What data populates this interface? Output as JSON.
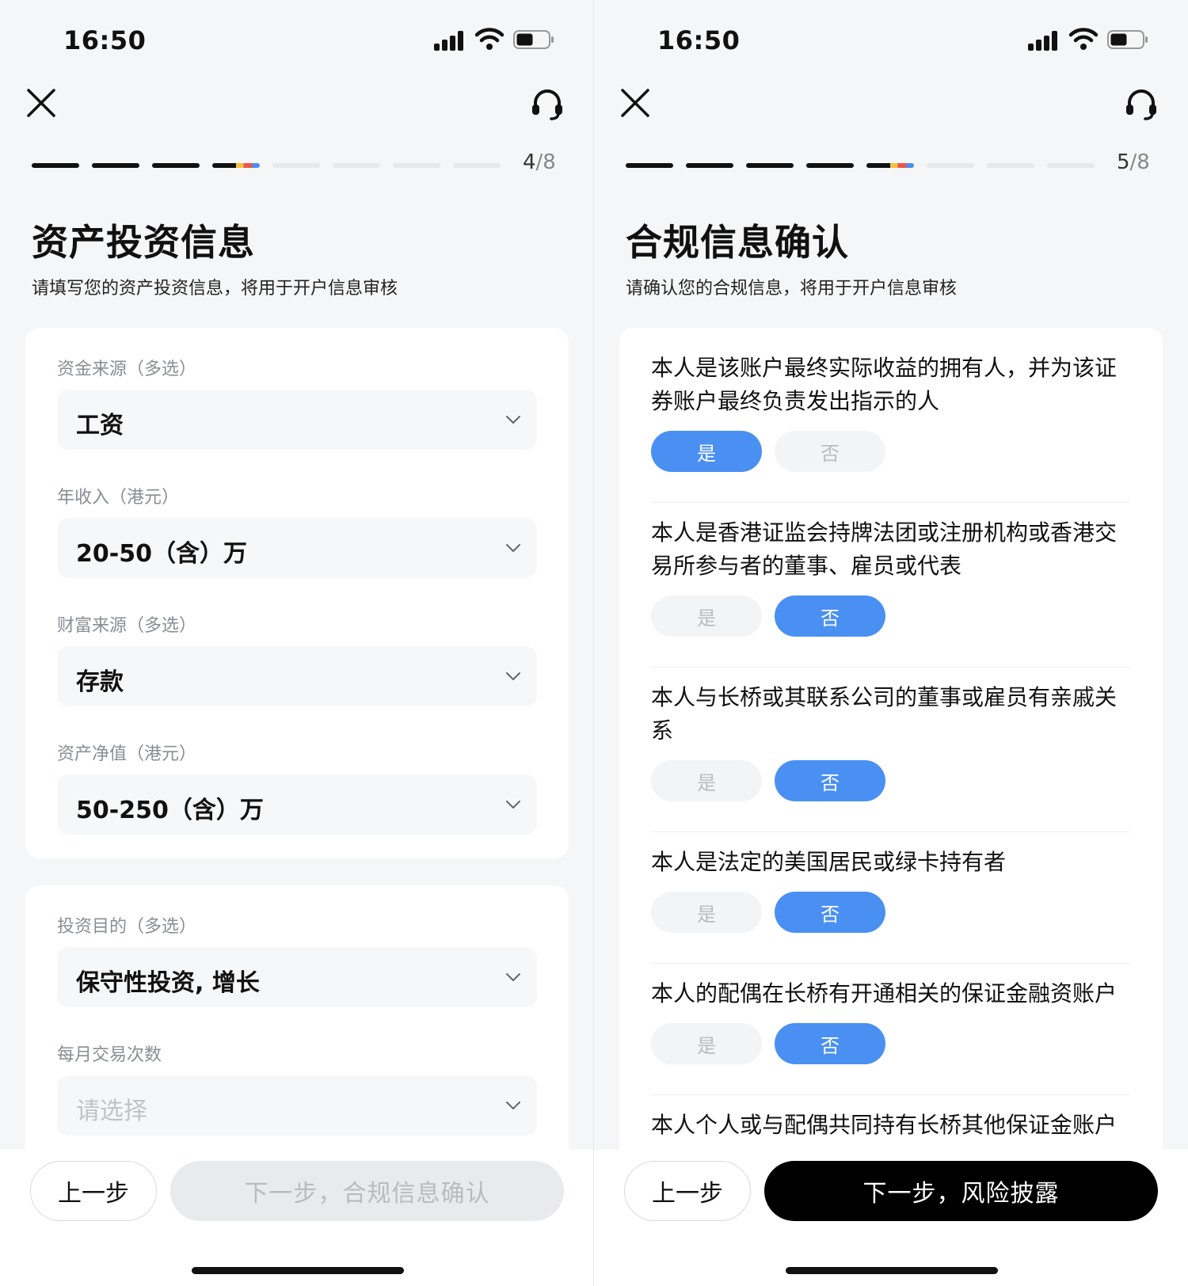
{
  "left": {
    "status": {
      "time": "16:50"
    },
    "progress": {
      "current": "4",
      "total": "/8",
      "done_segments": 3,
      "total_segments": 8
    },
    "title": "资产投资信息",
    "subtitle": "请填写您的资产投资信息，将用于开户信息审核",
    "card1": [
      {
        "label": "资金来源（多选）",
        "value": "工资"
      },
      {
        "label": "年收入（港元）",
        "value": "20-50（含）万"
      },
      {
        "label": "财富来源（多选）",
        "value": "存款"
      },
      {
        "label": "资产净值（港元）",
        "value": "50-250（含）万"
      }
    ],
    "card2": [
      {
        "label": "投资目的（多选）",
        "value": "保守性投资, 增长"
      },
      {
        "label": "每月交易次数",
        "placeholder": "请选择"
      }
    ],
    "buttons": {
      "prev": "上一步",
      "next": "下一步，合规信息确认"
    }
  },
  "right": {
    "status": {
      "time": "16:50"
    },
    "progress": {
      "current": "5",
      "total": "/8",
      "done_segments": 4,
      "total_segments": 8
    },
    "title": "合规信息确认",
    "subtitle": "请确认您的合规信息，将用于开户信息审核",
    "yes_label": "是",
    "no_label": "否",
    "questions": [
      {
        "text": "本人是该账户最终实际收益的拥有人，并为该证券账户最终负责发出指示的人",
        "answer": "yes"
      },
      {
        "text": "本人是香港证监会持牌法团或注册机构或香港交易所参与者的董事、雇员或代表",
        "answer": "no"
      },
      {
        "text": "本人与长桥或其联系公司的董事或雇员有亲戚关系",
        "answer": "no"
      },
      {
        "text": "本人是法定的美国居民或绿卡持有者",
        "answer": "no"
      },
      {
        "text": "本人的配偶在长桥有开通相关的保证金融资账户",
        "answer": "no"
      },
      {
        "text": "本人个人或与配偶共同持有长桥其他保证金账户",
        "answer": ""
      }
    ],
    "buttons": {
      "prev": "上一步",
      "next": "下一步，风险披露"
    }
  },
  "colors": {
    "accent_blue": "#4a90f2",
    "primary_black": "#000000",
    "disabled_gray": "#e9eaec"
  }
}
